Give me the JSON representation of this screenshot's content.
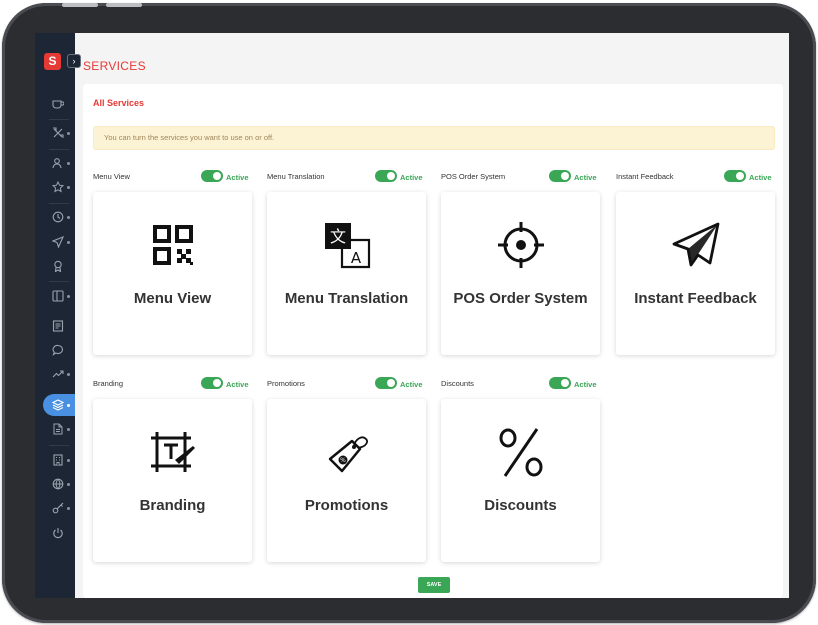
{
  "app": {
    "logo_letter": "S",
    "collapse_glyph": "›"
  },
  "header": {
    "title": "SERVICES"
  },
  "panel": {
    "title": "All Services",
    "notice": "You can turn the services you want to use on or off.",
    "save_label": "SAVE"
  },
  "colors": {
    "accent": "#e53935",
    "active": "#3aa757",
    "sidebar": "#1d2634",
    "sidebar_active": "#4a90e2"
  },
  "sidebar": {
    "items": [
      {
        "icon": "cup-icon"
      },
      {
        "icon": "tools-icon"
      },
      {
        "icon": "users-icon"
      },
      {
        "icon": "star-icon"
      },
      {
        "icon": "clock-icon"
      },
      {
        "icon": "send-icon"
      },
      {
        "icon": "award-icon"
      },
      {
        "icon": "layout-icon"
      },
      {
        "icon": "newspaper-icon"
      },
      {
        "icon": "chat-icon"
      },
      {
        "icon": "trending-icon"
      },
      {
        "icon": "layers-icon",
        "active": true
      },
      {
        "icon": "document-icon"
      },
      {
        "icon": "building-icon"
      },
      {
        "icon": "globe-icon"
      },
      {
        "icon": "key-icon"
      },
      {
        "icon": "power-icon"
      }
    ]
  },
  "services": [
    {
      "name": "Menu View",
      "status": "Active",
      "label": "Menu View",
      "icon": "qr-code-icon",
      "enabled": true
    },
    {
      "name": "Menu Translation",
      "status": "Active",
      "label": "Menu Translation",
      "icon": "translate-icon",
      "enabled": true
    },
    {
      "name": "POS Order System",
      "status": "Active",
      "label": "POS Order System",
      "icon": "crosshair-icon",
      "enabled": true
    },
    {
      "name": "Instant Feedback",
      "status": "Active",
      "label": "Instant Feedback",
      "icon": "paper-plane-icon",
      "enabled": true
    },
    {
      "name": "Branding",
      "status": "Active",
      "label": "Branding",
      "icon": "branding-icon",
      "enabled": true
    },
    {
      "name": "Promotions",
      "status": "Active",
      "label": "Promotions",
      "icon": "price-tag-icon",
      "enabled": true
    },
    {
      "name": "Discounts",
      "status": "Active",
      "label": "Discounts",
      "icon": "percent-icon",
      "enabled": true
    }
  ]
}
